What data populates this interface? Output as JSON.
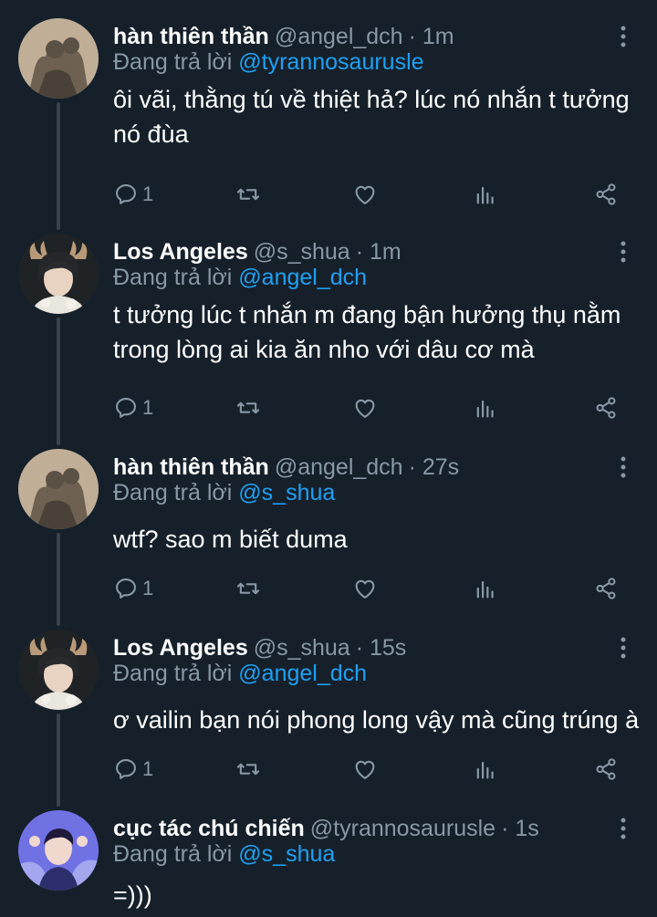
{
  "tweets": [
    {
      "name": "hàn thiên thần",
      "handle": "@angel_dch",
      "time": "· 1m",
      "reply_prefix": "Đang trả lời ",
      "reply_to": "@tyrannosaurusle",
      "text": "ôi vãi, thằng tú về thiệt hả? lúc nó nhắn t tưởng nó đùa",
      "reply_count": "1",
      "avatar": "sepia-silhouette-avatar"
    },
    {
      "name": "Los Angeles",
      "handle": "@s_shua",
      "time": "· 1m",
      "reply_prefix": "Đang trả lời ",
      "reply_to": "@angel_dch",
      "text": "t tưởng lúc t nhắn m đang bận hưởng thụ nằm trong lòng ai kia ăn nho với dâu cơ mà",
      "reply_count": "1",
      "avatar": "person-with-antlers-avatar"
    },
    {
      "name": "hàn thiên thần",
      "handle": "@angel_dch",
      "time": "· 27s",
      "reply_prefix": "Đang trả lời ",
      "reply_to": "@s_shua",
      "text": "wtf? sao m biết duma",
      "reply_count": "1",
      "avatar": "sepia-silhouette-avatar"
    },
    {
      "name": "Los Angeles",
      "handle": "@s_shua",
      "time": "· 15s",
      "reply_prefix": "Đang trả lời ",
      "reply_to": "@angel_dch",
      "text": "ơ vailin bạn nói phong long vậy mà cũng trúng à",
      "reply_count": "1",
      "avatar": "person-with-antlers-avatar"
    },
    {
      "name": "cục tác chú chiến",
      "handle": "@tyrannosaurusle",
      "time": "· 1s",
      "reply_prefix": "Đang trả lời ",
      "reply_to": "@s_shua",
      "text": "=)))",
      "reply_count": "",
      "avatar": "purple-portrait-avatar"
    }
  ],
  "colors": {
    "background": "#15202b",
    "muted_text": "#8899a6",
    "mention": "#1da1f2",
    "thread_line": "#38444d"
  },
  "icons": [
    "reply-icon",
    "retweet-icon",
    "like-icon",
    "analytics-icon",
    "share-icon",
    "more-options-icon"
  ]
}
